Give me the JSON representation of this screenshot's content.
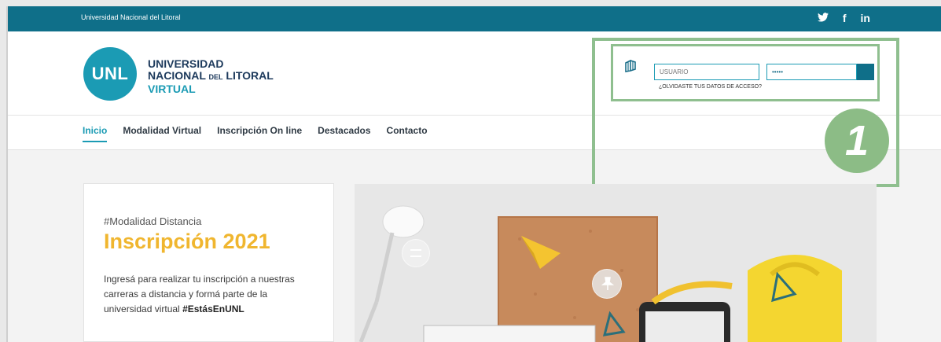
{
  "topbar": {
    "institution": "Universidad Nacional del Litoral",
    "social": [
      {
        "icon": "twitter-icon",
        "glyph": "🐦"
      },
      {
        "icon": "facebook-icon",
        "glyph": "f"
      },
      {
        "icon": "linkedin-icon",
        "glyph": "in"
      }
    ]
  },
  "logo": {
    "mark": "UNL",
    "line1": "UNIVERSIDAD",
    "line2_a": "NACIONAL",
    "line2_b": "DEL",
    "line2_c": "LITORAL",
    "line3": "VIRTUAL"
  },
  "login": {
    "user_placeholder": "USUARIO",
    "password_value": "•••••",
    "forgot": "¿OLVIDASTE TUS DATOS DE ACCESO?"
  },
  "nav": {
    "items": [
      "Inicio",
      "Modalidad Virtual",
      "Inscripción On line",
      "Destacados",
      "Contacto"
    ]
  },
  "badge": {
    "number": "1"
  },
  "card": {
    "tag": "#Modalidad Distancia",
    "title": "Inscripción 2021",
    "desc_text": "Ingresá para realizar tu inscripción a nuestras carreras a distancia y formá parte de la universidad virtual ",
    "desc_bold": "#EstásEnUNL"
  },
  "colors": {
    "primary": "#0f6f89",
    "accent": "#1b9bb4",
    "highlight": "#f0b62f",
    "annotation": "#8cbc86"
  }
}
